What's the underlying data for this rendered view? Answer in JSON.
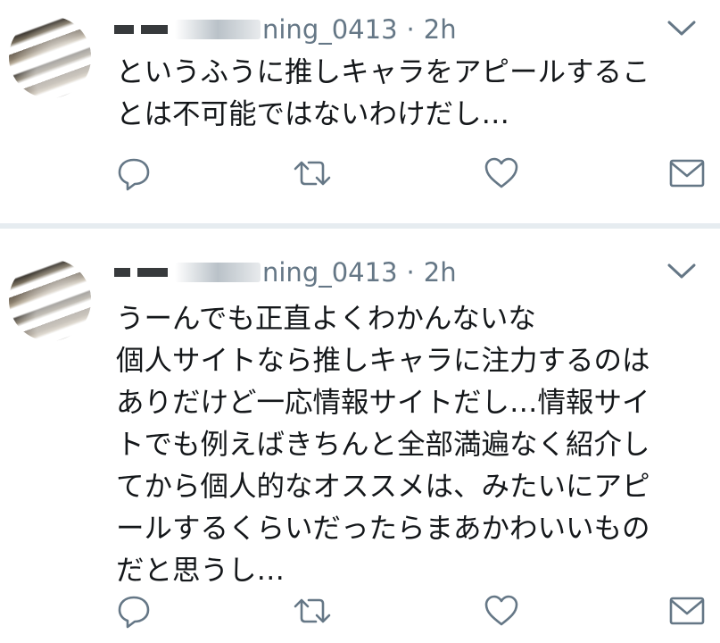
{
  "tweets": [
    {
      "handle_visible": "ning_0413",
      "dot": "·",
      "time": "2h",
      "lines": [
        "というふうに推しキャラをアピールするこ",
        "とは不可能ではないわけだし…"
      ]
    },
    {
      "handle_visible": "ning_0413",
      "dot": "·",
      "time": "2h",
      "lines": [
        "うーんでも正直よくわかんないな",
        "個人サイトなら推しキャラに注力するのは",
        "ありだけど一応情報サイトだし…情報サイ",
        "トでも例えばきちんと全部満遍なく紹介し",
        "てから個人的なオススメは、みたいにアピ",
        "ールするくらいだったらまあかわいいもの",
        "だと思うし…"
      ]
    }
  ],
  "icons": {
    "more": "chevron-down-icon",
    "reply": "reply-icon",
    "retweet": "retweet-icon",
    "like": "heart-icon",
    "dm": "envelope-icon"
  },
  "colors": {
    "text": "#14171a",
    "secondary": "#657786",
    "divider": "#e6ecf0"
  }
}
